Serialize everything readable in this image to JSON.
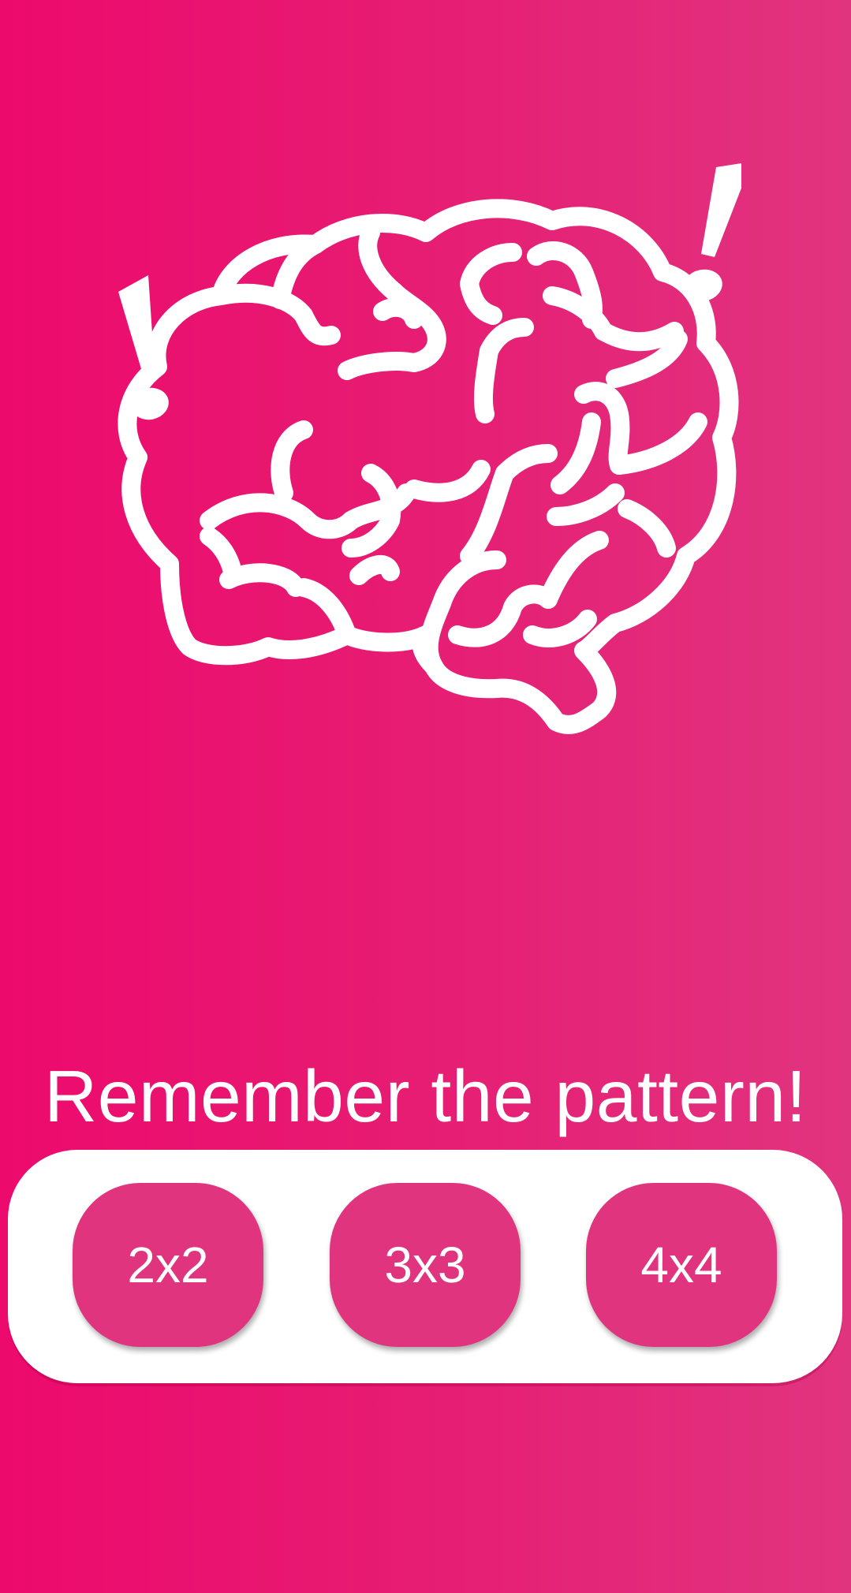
{
  "app": {
    "title": "Remember the pattern!"
  },
  "illustration": {
    "icon": "brain-icon",
    "accents": [
      "exclamation-icon",
      "exclamation-icon"
    ]
  },
  "modes": [
    {
      "label": "2x2"
    },
    {
      "label": "3x3"
    },
    {
      "label": "4x4"
    }
  ],
  "colors": {
    "background_start": "#ed0a6d",
    "background_end": "#e1347f",
    "panel": "#ffffff",
    "button": "#e1347f",
    "text": "#ffffff"
  }
}
